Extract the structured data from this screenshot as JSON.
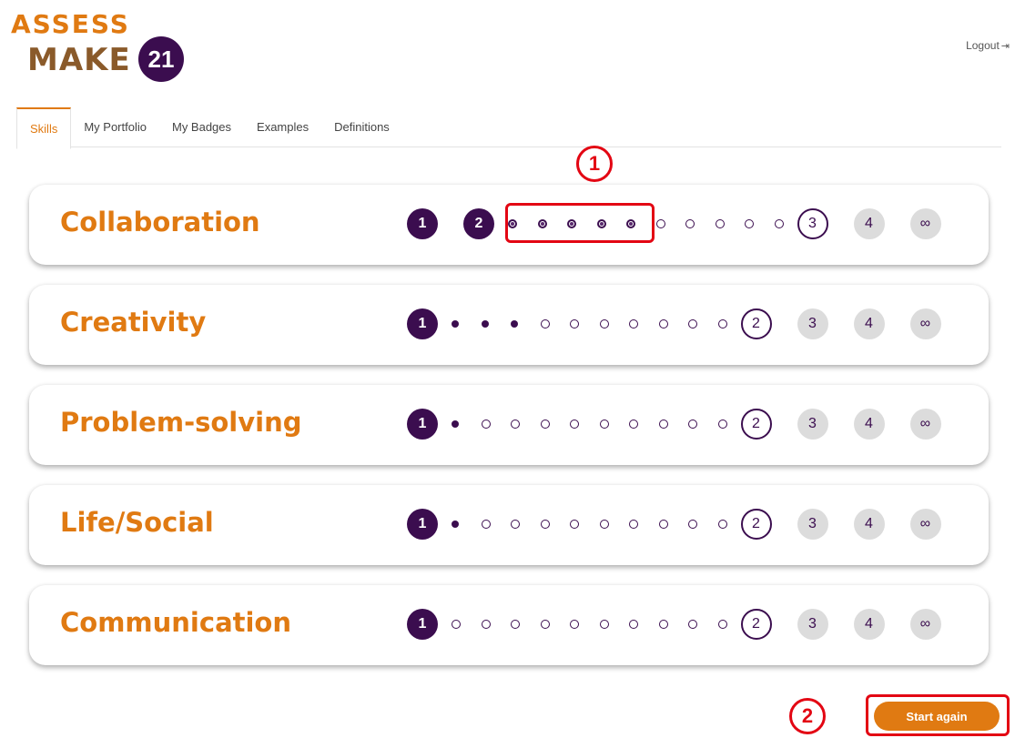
{
  "header": {
    "logo_top": "ASSESS",
    "logo_bottom": "MAKE",
    "logo_badge": "21",
    "logout_label": "Logout"
  },
  "tabs": [
    {
      "label": "Skills",
      "active": true
    },
    {
      "label": "My Portfolio"
    },
    {
      "label": "My Badges"
    },
    {
      "label": "Examples"
    },
    {
      "label": "Definitions"
    }
  ],
  "skills": [
    {
      "name": "Collaboration",
      "levels": [
        "1",
        "2",
        "3",
        "4",
        "∞"
      ],
      "current_level": 3,
      "dots_filled": 0,
      "dots_partial": 5,
      "dots_total": 10
    },
    {
      "name": "Creativity",
      "levels": [
        "1",
        "2",
        "3",
        "4",
        "∞"
      ],
      "current_level": 2,
      "dots_filled": 3,
      "dots_partial": 0,
      "dots_total": 10
    },
    {
      "name": "Problem-solving",
      "levels": [
        "1",
        "2",
        "3",
        "4",
        "∞"
      ],
      "current_level": 2,
      "dots_filled": 1,
      "dots_partial": 0,
      "dots_total": 10
    },
    {
      "name": "Life/Social",
      "levels": [
        "1",
        "2",
        "3",
        "4",
        "∞"
      ],
      "current_level": 2,
      "dots_filled": 1,
      "dots_partial": 0,
      "dots_total": 10
    },
    {
      "name": "Communication",
      "levels": [
        "1",
        "2",
        "3",
        "4",
        "∞"
      ],
      "current_level": 2,
      "dots_filled": 0,
      "dots_partial": 0,
      "dots_total": 10
    }
  ],
  "annotations": {
    "marker_1": "1",
    "marker_2": "2"
  },
  "actions": {
    "start_again_label": "Start again"
  },
  "colors": {
    "accent": "#e07a12",
    "level_fill": "#3b0d4f",
    "annotation": "#e30613"
  }
}
